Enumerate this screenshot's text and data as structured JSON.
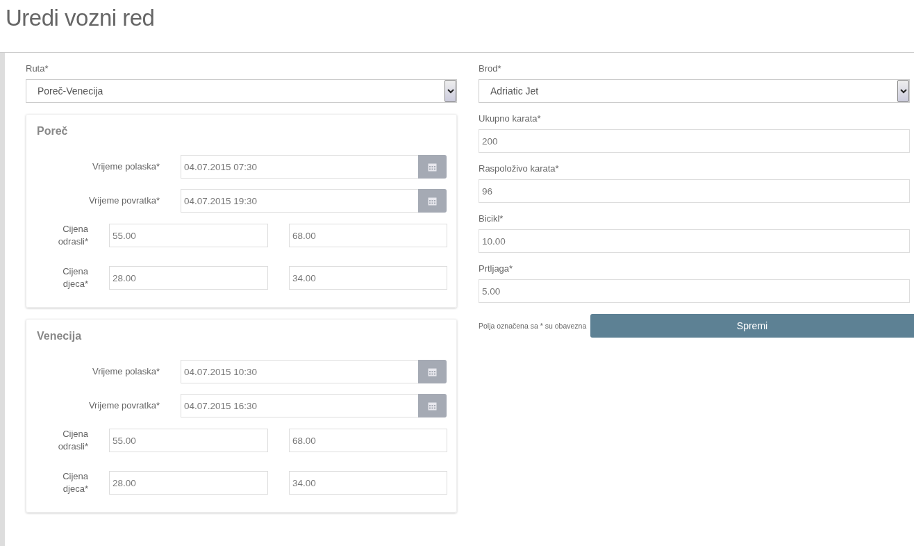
{
  "title": "Uredi vozni red",
  "route": {
    "label": "Ruta*",
    "value": "Poreč-Venecija"
  },
  "stops": [
    {
      "name": "Poreč",
      "times": [
        {
          "label": "Vrijeme polaska*",
          "value": "04.07.2015 07:30"
        },
        {
          "label": "Vrijeme povratka*",
          "value": "04.07.2015 19:30"
        }
      ],
      "prices": [
        {
          "label": "Cijena odrasli*",
          "values": [
            "55.00",
            "68.00"
          ]
        },
        {
          "label": "Cijena djeca*",
          "values": [
            "28.00",
            "34.00"
          ]
        }
      ]
    },
    {
      "name": "Venecija",
      "times": [
        {
          "label": "Vrijeme polaska*",
          "value": "04.07.2015 10:30"
        },
        {
          "label": "Vrijeme povratka*",
          "value": "04.07.2015 16:30"
        }
      ],
      "prices": [
        {
          "label": "Cijena odrasli*",
          "values": [
            "55.00",
            "68.00"
          ]
        },
        {
          "label": "Cijena djeca*",
          "values": [
            "28.00",
            "34.00"
          ]
        }
      ]
    }
  ],
  "ship": {
    "label": "Brod*",
    "value": "Adriatic Jet"
  },
  "fields": [
    {
      "label": "Ukupno karata*",
      "value": "200"
    },
    {
      "label": "Raspoloživo karata*",
      "value": "96"
    },
    {
      "label": "Bicikl*",
      "value": "10.00"
    },
    {
      "label": "Prtljaga*",
      "value": "5.00"
    }
  ],
  "note": "Polja označena sa * su obavezna",
  "save_button": "Spremi"
}
